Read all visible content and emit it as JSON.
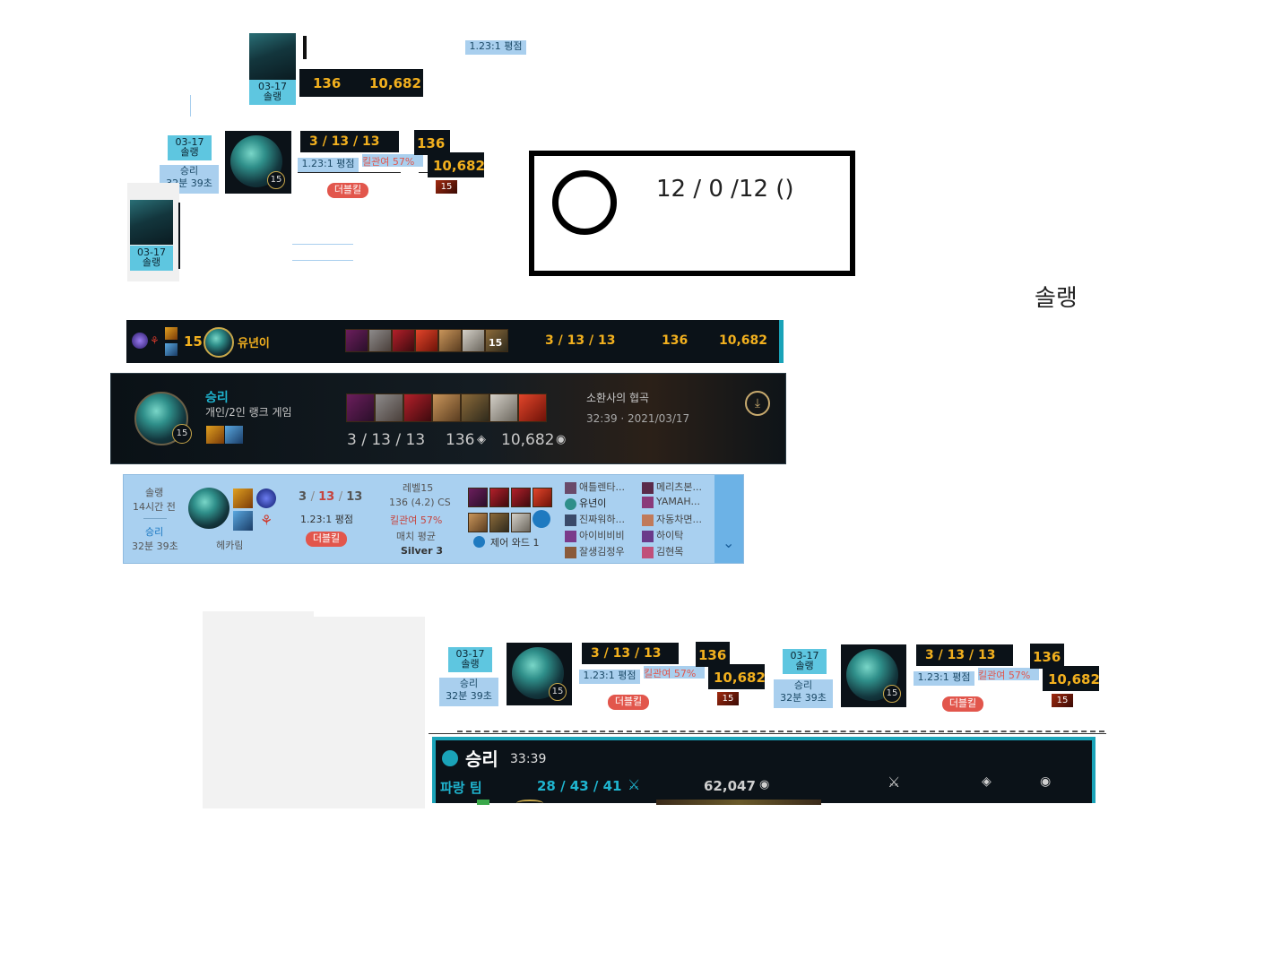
{
  "stats": {
    "kda": "3 / 13 / 13",
    "kda_spaced": "3 / 13 / 13",
    "cs": "136",
    "gold": "10,682",
    "ratio": "1.23:1 평점",
    "ratio_bold": "1.23:1",
    "ratio_suffix": "평점",
    "kp": "킬관여 57%",
    "multikill": "더블킬",
    "level": "15"
  },
  "card_small": {
    "date": "03-17",
    "queue": "솔랭",
    "result": "승리",
    "duration": "32분 39초"
  },
  "outline_box": {
    "kda_text": "12 / 0 /12 ()"
  },
  "floating_label": "솔랭",
  "player_row": {
    "level": "15",
    "name": "유년이",
    "item_level": "15"
  },
  "client_banner": {
    "result": "승리",
    "queue": "개인/2인 랭크 게임",
    "kda": "3 / 13 / 13",
    "cs": "136",
    "gold": "10,682",
    "map": "소환사의 협곡",
    "time_date": "32:39 · 2021/03/17",
    "level": "15"
  },
  "opgg_row": {
    "queue": "솔랭",
    "ago": "14시간 전",
    "result": "승리",
    "duration": "32분 39초",
    "champion": "헤카림",
    "kda_k": "3",
    "kda_d": "13",
    "kda_a": "13",
    "ratio": "1.23:1 평점",
    "multikill": "더블킬",
    "level": "레벨15",
    "cs": "136 (4.2) CS",
    "kp": "킬관여 57%",
    "avg_label": "매치 평균",
    "tier": "Silver 3",
    "ward": "제어 와드 1",
    "team1": [
      "애틀렌타...",
      "유년이",
      "진짜워하...",
      "아이비비비",
      "잘생김정우"
    ],
    "team2": [
      "메리츠본...",
      "YAMAH...",
      "자동차면...",
      "하이탁",
      "김현목"
    ]
  },
  "team_panel": {
    "result": "승리",
    "duration": "33:39",
    "team": "파랑 팀",
    "kda": "28 / 43 / 41",
    "gold": "62,047"
  },
  "colors": {
    "gold": "#f2b01e",
    "cyan": "#5ec6e0",
    "light_blue": "#a9cfee",
    "dark": "#0b1218",
    "red": "#e2564c",
    "teal": "#1aa3b8"
  }
}
